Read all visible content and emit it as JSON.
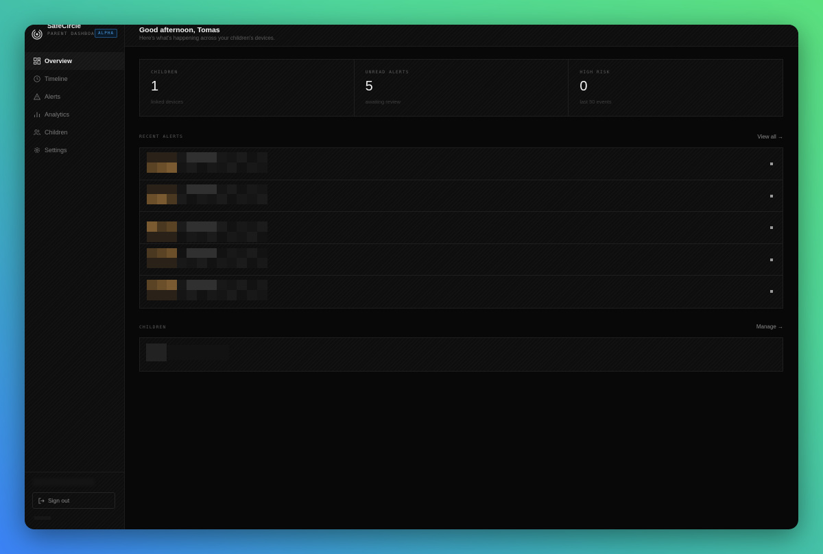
{
  "brand": {
    "name": "SafeCircle",
    "subtitle": "PARENT DASHBOARD",
    "badge": "ALPHA"
  },
  "nav": [
    {
      "label": "Overview",
      "icon": "grid-icon",
      "active": true
    },
    {
      "label": "Timeline",
      "icon": "clock-icon",
      "active": false
    },
    {
      "label": "Alerts",
      "icon": "warning-icon",
      "active": false
    },
    {
      "label": "Analytics",
      "icon": "bar-chart-icon",
      "active": false
    },
    {
      "label": "Children",
      "icon": "users-icon",
      "active": false
    },
    {
      "label": "Settings",
      "icon": "gear-icon",
      "active": false
    }
  ],
  "sidebar_footer": {
    "signout_label": "Sign out"
  },
  "header": {
    "greeting": "Good afternoon, Tomas",
    "subtitle": "Here's what's happening across your children's devices."
  },
  "stats": [
    {
      "label": "CHILDREN",
      "value": "1",
      "sub": "linked devices"
    },
    {
      "label": "UNREAD ALERTS",
      "value": "5",
      "sub": "awaiting review"
    },
    {
      "label": "HIGH RISK",
      "value": "0",
      "sub": "last 50 events"
    }
  ],
  "recent_alerts": {
    "title": "RECENT ALERTS",
    "link": "View all →",
    "count": 5
  },
  "children_section": {
    "title": "CHILDREN",
    "link": "Manage →"
  },
  "colors": {
    "accent": "#4a9ae0",
    "background": "#080808",
    "redaction_amber": "#6b4f2a"
  }
}
